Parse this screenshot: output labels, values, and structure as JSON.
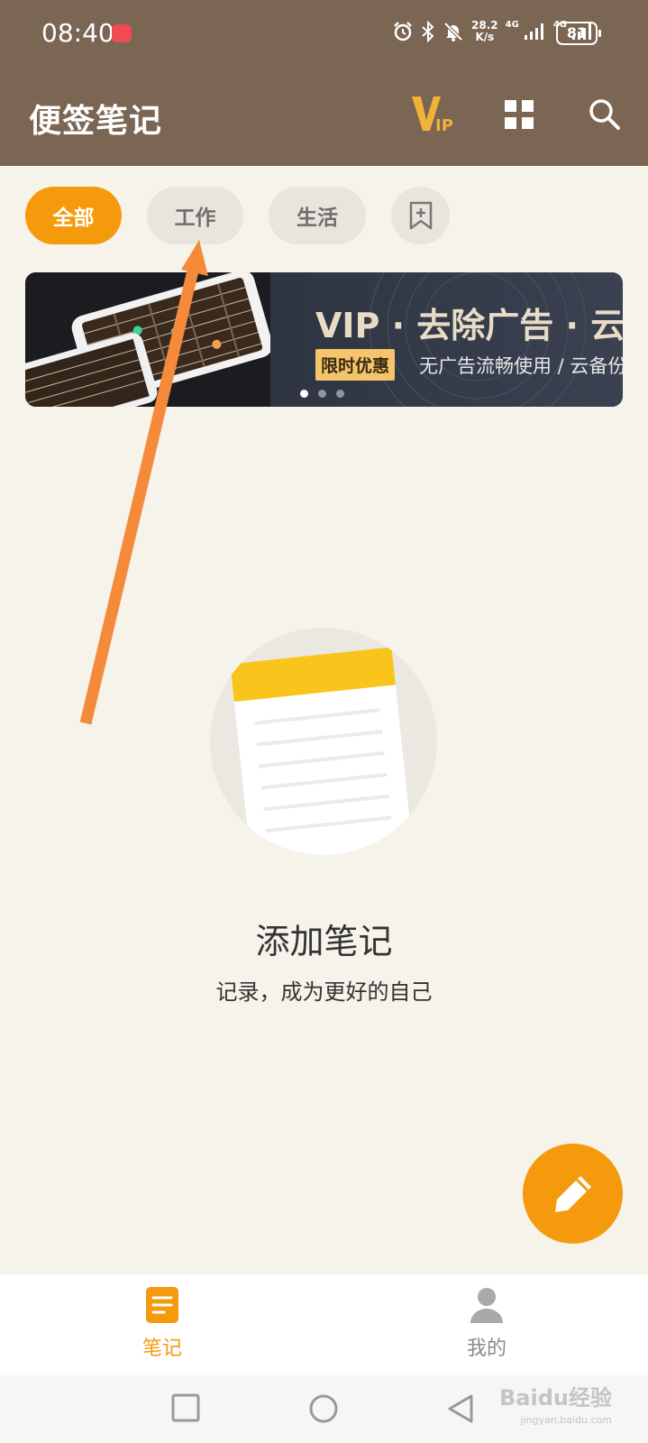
{
  "status_bar": {
    "time": "08:40",
    "net_speed_value": "28.2",
    "net_speed_unit": "K/s",
    "signal1_label": "4G",
    "signal2_label": "4G",
    "battery": "81"
  },
  "app_bar": {
    "title": "便签笔记",
    "icons": [
      "vip-icon",
      "grid-icon",
      "search-icon"
    ]
  },
  "tabs": [
    {
      "label": "全部",
      "active": true
    },
    {
      "label": "工作",
      "active": false
    },
    {
      "label": "生活",
      "active": false
    }
  ],
  "tab_add_icon": "bookmark-add-icon",
  "banner": {
    "headline": "VIP · 去除广告 · 云备份",
    "badge": "限时优惠",
    "subtitle": "无广告流畅使用 / 云备份",
    "dots_total": 3,
    "dots_active": 0
  },
  "empty_state": {
    "title": "添加笔记",
    "subtitle": "记录，成为更好的自己"
  },
  "fab_icon": "pencil-icon",
  "bottom_nav": [
    {
      "label": "笔记",
      "icon": "note-icon",
      "active": true
    },
    {
      "label": "我的",
      "icon": "person-icon",
      "active": false
    }
  ],
  "system_nav": [
    "recent-apps",
    "home",
    "back"
  ],
  "watermark": {
    "text": "Baidu经验",
    "sub": "jingyan.baidu.com"
  },
  "colors": {
    "brand_brown": "#7b6553",
    "accent_orange": "#f59a0c",
    "background": "#f6f3eb"
  }
}
